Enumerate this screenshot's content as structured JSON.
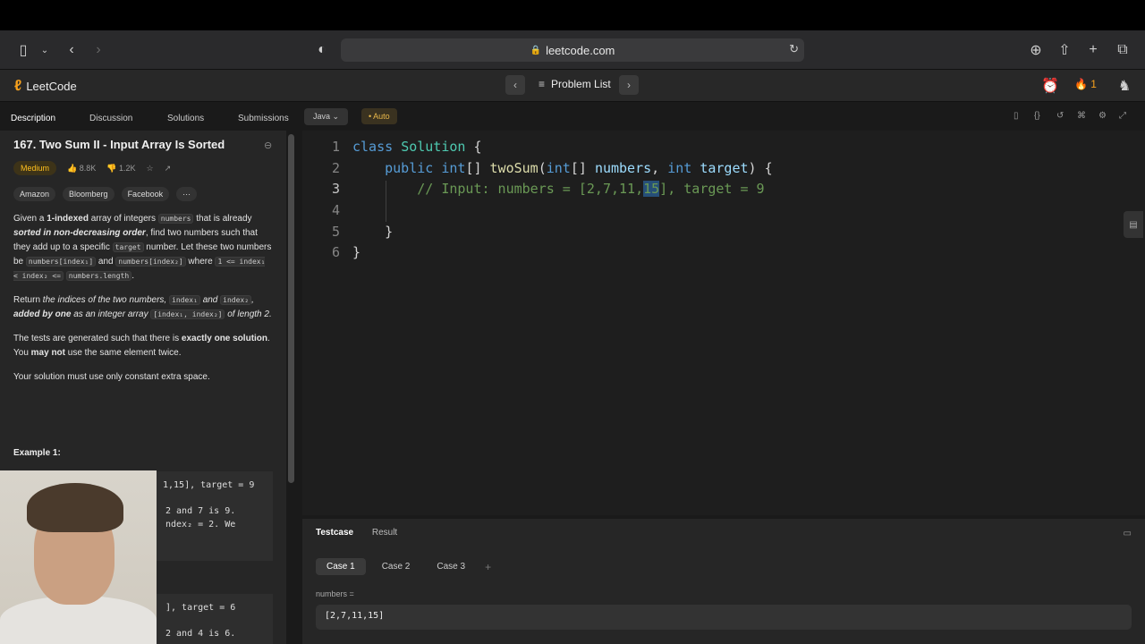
{
  "browser": {
    "url": "leetcode.com"
  },
  "nav": {
    "logo": "LeetCode",
    "problem_list": "Problem List",
    "streak": "1"
  },
  "tabs": [
    "Description",
    "Discussion",
    "Solutions",
    "Submissions"
  ],
  "problem": {
    "title": "167. Two Sum II - Input Array Is Sorted",
    "difficulty": "Medium",
    "likes": "8.8K",
    "dislikes": "1.2K",
    "companies": [
      "Amazon",
      "Bloomberg",
      "Facebook",
      "···"
    ],
    "example_label": "Example 1:",
    "ex1_line1": "1,15], target = 9",
    "ex1_line2": "2 and 7 is 9.",
    "ex1_line3": "ndex₂ = 2. We",
    "ex2_line1": "], target = 6",
    "ex2_line2": "2 and 4 is 6."
  },
  "editor": {
    "language": "Java",
    "mode": "Auto",
    "line_numbers": [
      "1",
      "2",
      "3",
      "4",
      "5",
      "6"
    ]
  },
  "testpanel": {
    "tabs": [
      "Testcase",
      "Result"
    ],
    "cases": [
      "Case 1",
      "Case 2",
      "Case 3"
    ],
    "add": "+",
    "var_label": "numbers =",
    "var_value": "[2,7,11,15]"
  }
}
